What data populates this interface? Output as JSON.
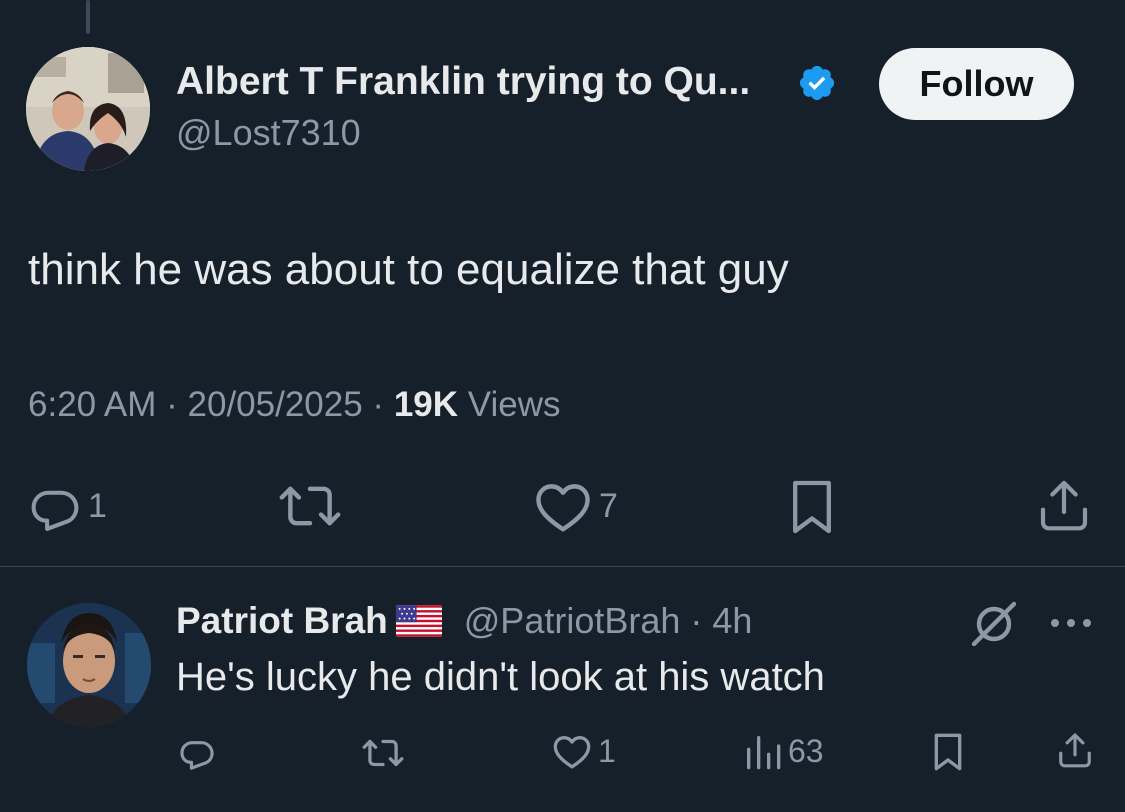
{
  "tweet": {
    "author_name": "Albert T Franklin trying to Qu...",
    "author_handle": "@Lost7310",
    "follow_label": "Follow",
    "text": "think he was about to equalize that guy",
    "time": "6:20 AM",
    "separator": " · ",
    "date": "20/05/2025",
    "views_count": "19K",
    "views_label": " Views",
    "reply_count": "1",
    "like_count": "7"
  },
  "reply": {
    "author_name": "Patriot Brah",
    "handle_time": "@PatriotBrah · 4h",
    "text": "He's lucky he didn't look at his watch",
    "like_count": "1",
    "views_count": "63"
  },
  "colors": {
    "background": "#16202b",
    "primary_text": "#e7e9ea",
    "secondary_text": "#8b98a5",
    "verified_blue": "#1d9bf0",
    "follow_button_bg": "#eff3f4",
    "divider": "#38444d"
  },
  "icons": {
    "verified": "verified-badge-icon",
    "reply": "reply-icon",
    "repost": "repost-icon",
    "like": "like-icon",
    "bookmark": "bookmark-icon",
    "share": "share-icon",
    "views": "views-icon",
    "grok": "grok-icon",
    "more": "more-icon",
    "flag": "us-flag-icon"
  }
}
